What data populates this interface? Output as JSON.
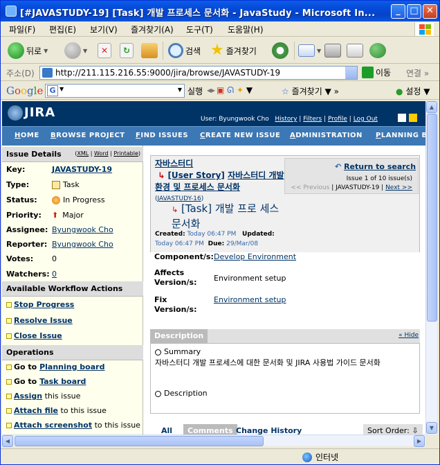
{
  "window": {
    "title": "[#JAVASTUDY-19] [Task] 개발 프로세스 문서화 - JavaStudy - Microsoft In..."
  },
  "menu": [
    "파일(F)",
    "편집(E)",
    "보기(V)",
    "즐겨찾기(A)",
    "도구(T)",
    "도움말(H)"
  ],
  "toolbar": {
    "back": "뒤로",
    "search": "검색",
    "favorites": "즐겨찾기"
  },
  "address": {
    "label": "주소(D)",
    "url": "http://211.115.216.55:9000/jira/browse/JAVASTUDY-19",
    "go": "이동",
    "links": "연결"
  },
  "google": {
    "logo": "Google",
    "engine": "G",
    "run": "실행",
    "favorites": "즐겨찾기",
    "settings": "설정"
  },
  "jira": {
    "logo": "JIRA",
    "user": "User: Byungwook Cho",
    "links": [
      "History",
      "Filters",
      "Profile",
      "Log Out"
    ],
    "nav": [
      {
        "first": "H",
        "rest": "OME"
      },
      {
        "first": "B",
        "rest": "ROWSE PROJECT"
      },
      {
        "first": "F",
        "rest": "IND ISSUES"
      },
      {
        "first": "C",
        "rest": "REATE NEW ISSUE"
      },
      {
        "first": "A",
        "rest": "DMINISTRATION"
      },
      {
        "first": "P",
        "rest": "LANNING B"
      }
    ]
  },
  "issue_details": {
    "heading": "Issue Details",
    "views": [
      "XML",
      "Word",
      "Printable"
    ],
    "key_label": "Key:",
    "key": "JAVASTUDY-19",
    "type_label": "Type:",
    "type": "Task",
    "status_label": "Status:",
    "status": "In Progress",
    "priority_label": "Priority:",
    "priority": "Major",
    "assignee_label": "Assignee:",
    "assignee": "Byungwook Cho",
    "reporter_label": "Reporter:",
    "reporter": "Byungwook Cho",
    "votes_label": "Votes:",
    "votes": "0",
    "watchers_label": "Watchers:",
    "watchers": "0"
  },
  "workflow": {
    "heading": "Available Workflow Actions",
    "actions": [
      "Stop Progress",
      "Resolve Issue",
      "Close Issue"
    ]
  },
  "operations": {
    "heading": "Operations",
    "items": [
      {
        "pre": "Go to ",
        "link": "Planning board",
        "post": ""
      },
      {
        "pre": "Go to ",
        "link": "Task board",
        "post": ""
      },
      {
        "pre": "",
        "link": "Assign",
        "post": " this issue"
      },
      {
        "pre": "",
        "link": "Attach file",
        "post": " to this issue"
      },
      {
        "pre": "",
        "link": "Attach screenshot",
        "post": " to this issue"
      }
    ]
  },
  "summary": {
    "project": "자바스터디",
    "parent_type": "[User Story]",
    "parent_title": "자바스터디 개발 환경 및 프로세스 문서화",
    "parent_key": "JAVASTUDY-16",
    "type": "[Task]",
    "title": "개발 프로 세스 문서화",
    "created_label": "Created:",
    "created": "Today 06:47 PM",
    "updated_label": "Updated:",
    "updated": "Today 06:47 PM",
    "due_label": "Due:",
    "due": "29/Mar/08"
  },
  "navbox": {
    "return": "Return to search",
    "count": "Issue 1 of 10 issue(s)",
    "prev": "<< Previous",
    "current": "JAVASTUDY-19",
    "next": "Next >>"
  },
  "fields": {
    "component_label": "Component/s:",
    "component": "Develop Environment",
    "affects_label": "Affects Version/s:",
    "affects": "Environment setup",
    "fix_label": "Fix Version/s:",
    "fix": "Environment setup"
  },
  "description": {
    "tab": "Description",
    "hide": "« Hide",
    "summary_head": "Summary",
    "summary_text": "자바스터디 개발 프로세스에 대한 문서화 및 JIRA 사용법 가이드 문서화",
    "desc_head": "Description"
  },
  "bottom_tabs": {
    "all": "All",
    "comments": "Comments",
    "history": "Change History",
    "sort": "Sort Order:"
  },
  "status": {
    "zone": "인터넷"
  },
  "colors": {
    "jira_dark": "#003366",
    "jira_nav": "#3c78b5",
    "xp_title": "#0648d6"
  }
}
